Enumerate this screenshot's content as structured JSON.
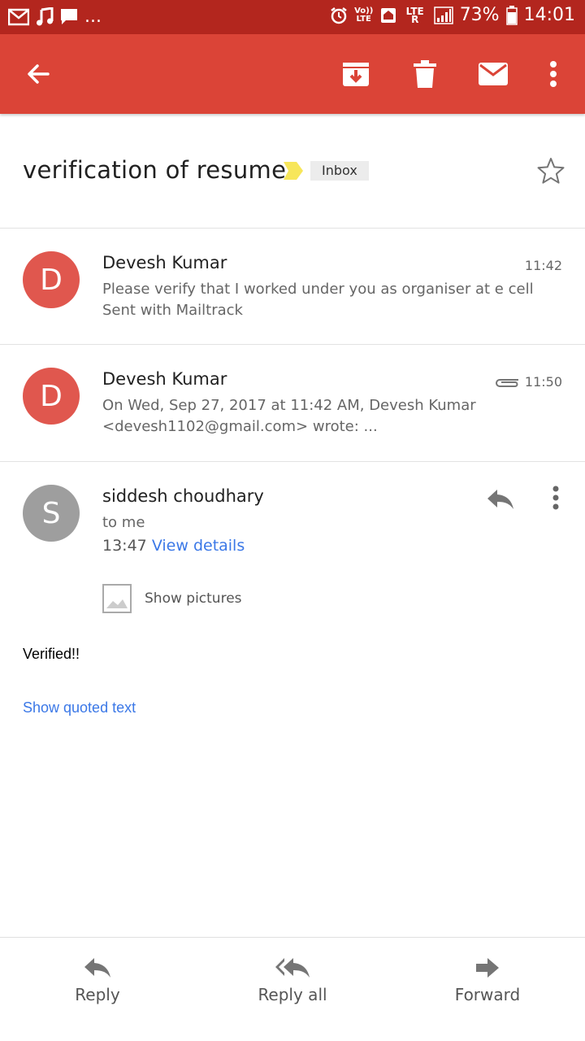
{
  "status_bar": {
    "volte": "Vo)) LTE",
    "network": "LTE R",
    "battery": "73%",
    "time": "14:01",
    "notification_more": "..."
  },
  "app_bar": {
    "icons": [
      "back-arrow-icon",
      "archive-icon",
      "delete-icon",
      "mark-unread-icon",
      "more-vert-icon"
    ]
  },
  "thread": {
    "subject": "verification of resume",
    "label": "Inbox"
  },
  "messages": [
    {
      "sender": "Devesh Kumar",
      "initial": "D",
      "time": "11:42",
      "snippet": "Please verify that I worked under you as organiser at e cell Sent with Mailtrack",
      "avatar_color": "#e0574e"
    },
    {
      "sender": "Devesh Kumar",
      "initial": "D",
      "time": "11:50",
      "snippet": "On Wed, Sep 27, 2017 at 11:42 AM, Devesh Kumar <devesh1102@gmail.com> wrote: ...",
      "avatar_color": "#e0574e"
    }
  ],
  "open_message": {
    "sender": "siddesh choudhary",
    "initial": "S",
    "recipient": "to me",
    "time": "13:47",
    "view_details": "View details",
    "show_pictures": "Show pictures",
    "body": "Verified!!",
    "show_quoted": "Show quoted text",
    "avatar_color": "#9e9e9e"
  },
  "bottom_actions": {
    "reply": "Reply",
    "reply_all": "Reply all",
    "forward": "Forward"
  },
  "colors": {
    "status_bar": "#b3261e",
    "app_bar": "#db4437",
    "link": "#3b78e7"
  }
}
